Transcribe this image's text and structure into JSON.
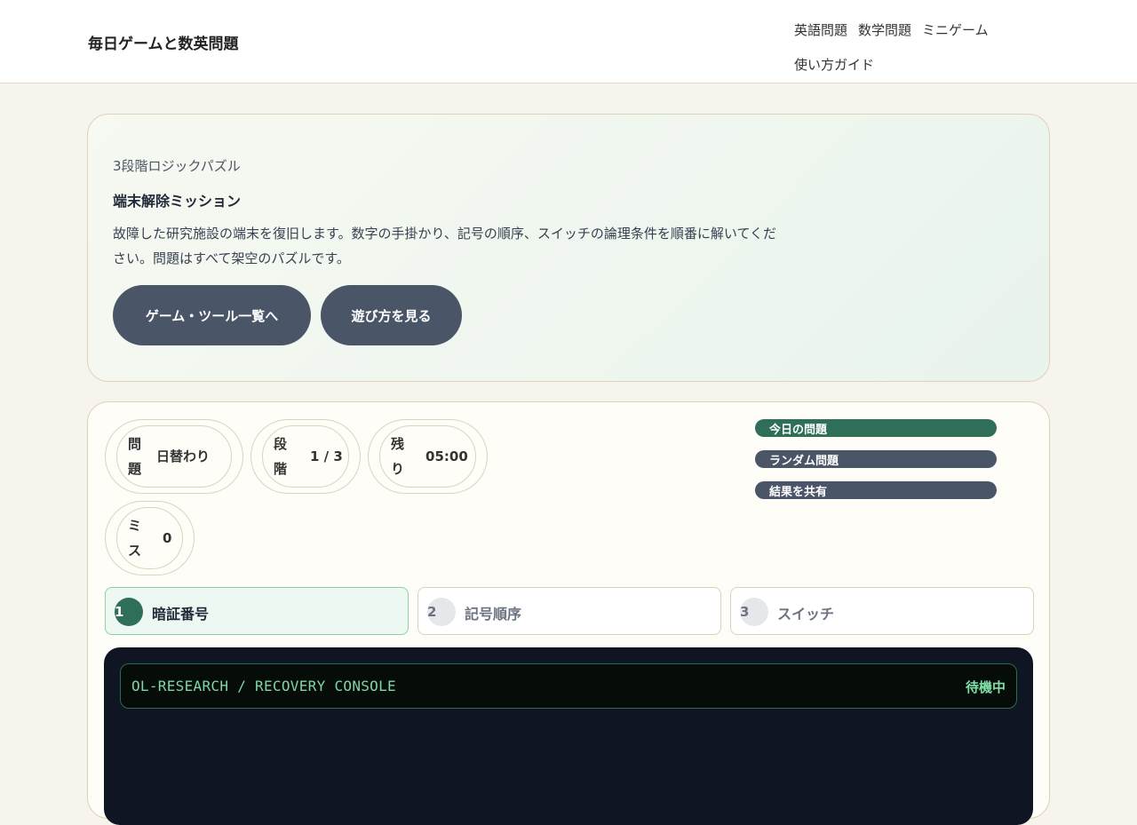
{
  "header": {
    "brand": "毎日ゲームと数英問題",
    "nav": [
      "英語問題",
      "数学問題",
      "ミニゲーム",
      "使い方ガイド"
    ]
  },
  "intro": {
    "eyebrow": "3段階ロジックパズル",
    "title": "端末解除ミッション",
    "description": "故障した研究施設の端末を復旧します。数字の手掛かり、記号の順序、スイッチの論理条件を順番に解いてください。問題はすべて架空のパズルです。",
    "buttons": {
      "list": "ゲーム・ツール一覧へ",
      "guide": "遊び方を見る"
    }
  },
  "stats": {
    "problem": {
      "label": "問題",
      "value": "日替わり"
    },
    "stage": {
      "label": "段階",
      "value": "1 / 3"
    },
    "remaining": {
      "label": "残り",
      "value": "05:00"
    },
    "miss": {
      "label": "ミス",
      "value": "0"
    }
  },
  "actions": {
    "today": {
      "label": "今日の問題",
      "color": "#2f6f5a"
    },
    "random": {
      "label": "ランダム問題",
      "color": "#4a5568"
    },
    "share": {
      "label": "結果を共有",
      "color": "#4a5568"
    }
  },
  "tabs": [
    {
      "num": "1",
      "label": "暗証番号",
      "active": true
    },
    {
      "num": "2",
      "label": "記号順序",
      "active": false
    },
    {
      "num": "3",
      "label": "スイッチ",
      "active": false
    }
  ],
  "console": {
    "title": "OL-RESEARCH / RECOVERY CONSOLE",
    "status": "待機中"
  }
}
